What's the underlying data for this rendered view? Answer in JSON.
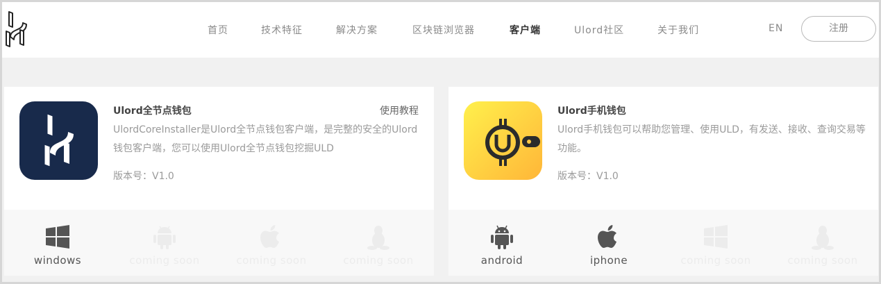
{
  "nav": {
    "items": [
      {
        "label": "首页",
        "active": false
      },
      {
        "label": "技术特征",
        "active": false
      },
      {
        "label": "解决方案",
        "active": false
      },
      {
        "label": "区块链浏览器",
        "active": false
      },
      {
        "label": "客户端",
        "active": true
      },
      {
        "label": "Ulord社区",
        "active": false
      },
      {
        "label": "关于我们",
        "active": false
      }
    ],
    "lang": "EN",
    "register": "注册"
  },
  "cards": [
    {
      "title": "Ulord全节点钱包",
      "tutorial": "使用教程",
      "desc": "UlordCoreInstaller是Ulord全节点钱包客户端，是完整的安全的Ulord钱包客户端，您可以使用Ulord全节点钱包挖掘ULD",
      "version": "版本号：V1.0",
      "icon": "ulord-logo-icon",
      "platforms": [
        {
          "icon": "windows-icon",
          "label": "windows",
          "available": true
        },
        {
          "icon": "android-icon",
          "label": "coming soon",
          "available": false
        },
        {
          "icon": "apple-icon",
          "label": "coming soon",
          "available": false
        },
        {
          "icon": "linux-icon",
          "label": "coming soon",
          "available": false
        }
      ]
    },
    {
      "title": "Ulord手机钱包",
      "desc": "Ulord手机钱包可以帮助您管理、使用ULD，有发送、接收、查询交易等功能。",
      "version": "版本号：V1.0",
      "icon": "ulord-wallet-icon",
      "platforms": [
        {
          "icon": "android-icon",
          "label": "android",
          "available": true
        },
        {
          "icon": "apple-icon",
          "label": "iphone",
          "available": true
        },
        {
          "icon": "windows-icon",
          "label": "coming soon",
          "available": false
        },
        {
          "icon": "linux-icon",
          "label": "coming soon",
          "available": false
        }
      ]
    }
  ],
  "colors": {
    "icon_dark_bg": "#182a4b",
    "icon_yellow_top": "#fff04c",
    "icon_yellow_bottom": "#ffb638",
    "platform_active": "#555555",
    "platform_disabled": "#ececec"
  }
}
